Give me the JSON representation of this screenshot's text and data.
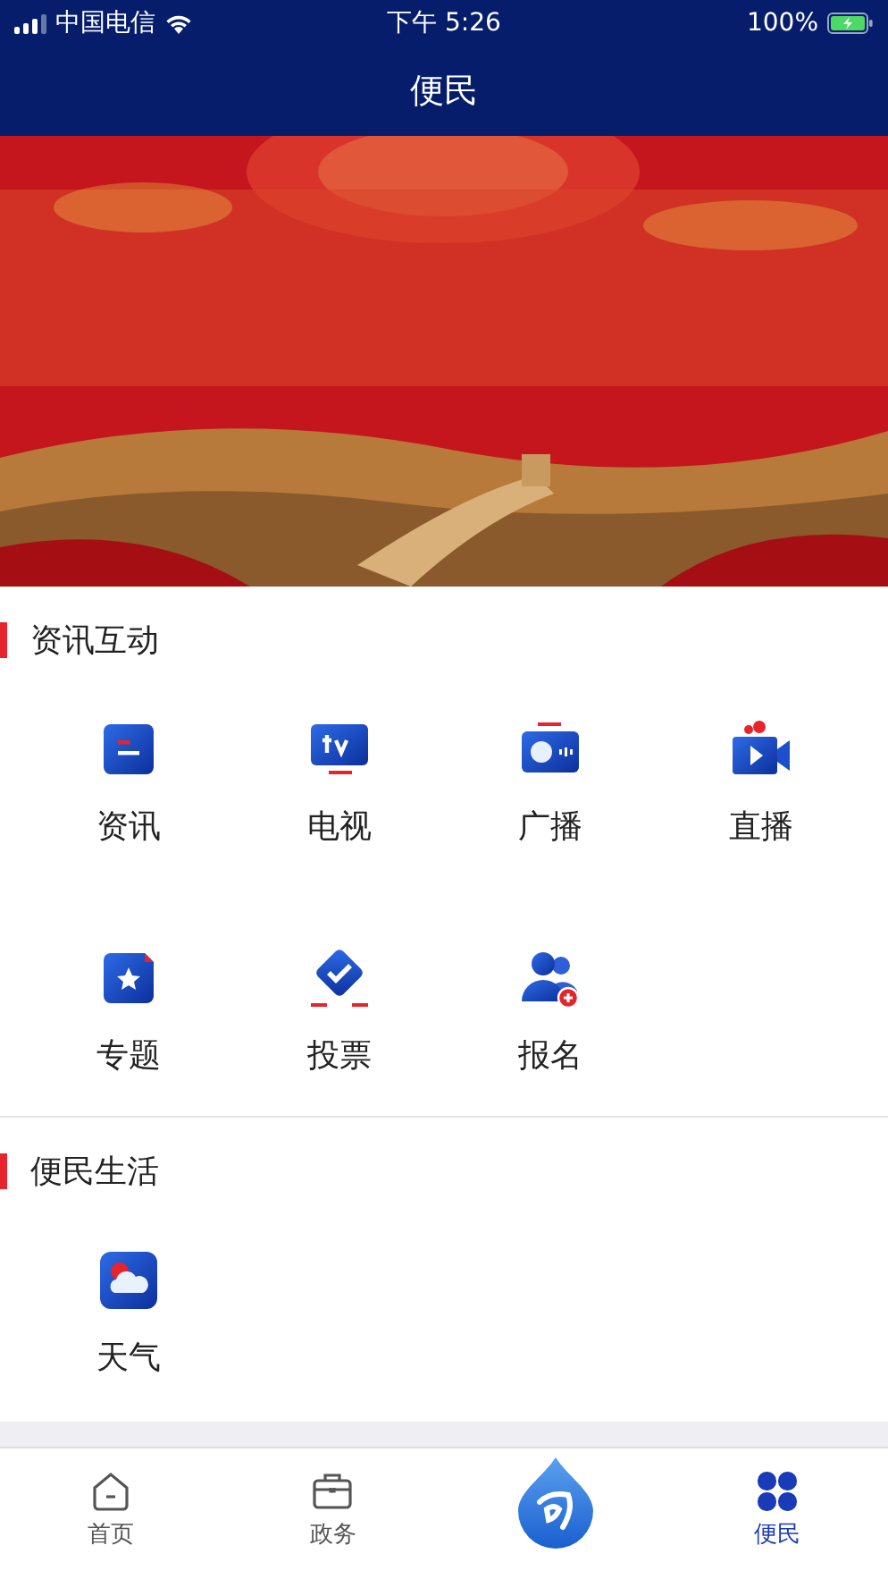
{
  "status_bar": {
    "carrier": "中国电信",
    "time": "下午 5:26",
    "battery": "100%"
  },
  "nav_bar": {
    "title": "便民"
  },
  "sections": [
    {
      "title": "资讯互动",
      "items": [
        {
          "label": "资讯"
        },
        {
          "label": "电视"
        },
        {
          "label": "广播"
        },
        {
          "label": "直播"
        },
        {
          "label": "专题"
        },
        {
          "label": "投票"
        },
        {
          "label": "报名"
        }
      ]
    },
    {
      "title": "便民生活",
      "items": [
        {
          "label": "天气"
        }
      ]
    }
  ],
  "tab_bar": [
    {
      "label": "首页",
      "selected": false
    },
    {
      "label": "政务",
      "selected": false
    },
    {
      "kind": "center",
      "selected": false
    },
    {
      "label": "便民",
      "selected": true
    }
  ]
}
